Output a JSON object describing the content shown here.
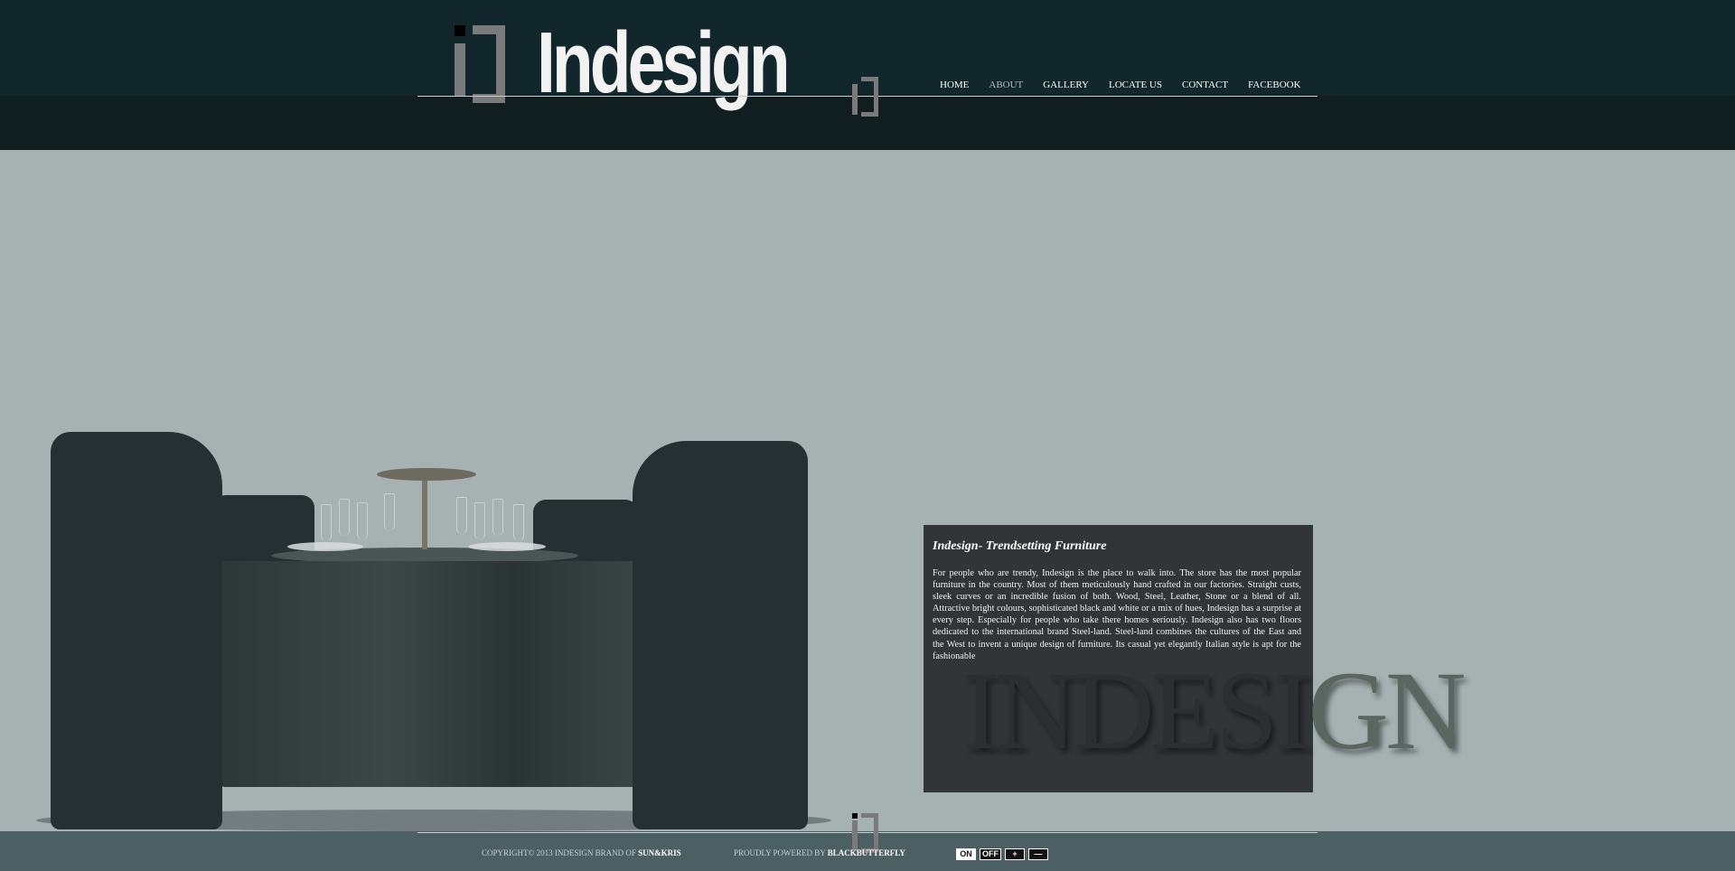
{
  "header": {
    "logo_text": "Indesign",
    "nav": [
      {
        "label": "HOME",
        "active": false
      },
      {
        "label": "ABOUT",
        "active": true
      },
      {
        "label": "GALLERY",
        "active": false
      },
      {
        "label": "LOCATE US",
        "active": false
      },
      {
        "label": "CONTACT",
        "active": false
      },
      {
        "label": "FACEBOOK",
        "active": false
      }
    ]
  },
  "info": {
    "title": "Indesign- Trendsetting Furniture",
    "body": "For people who are trendy, Indesign is the place to walk into. The store has the most popular furniture in the country. Most of them meticulously hand crafted in our factories. Straight custs, sleek curves or an incredible fusion of both. Wood, Steel, Leather, Stone or a blend of all. Attractive bright colours, sophisticated black and white or a mix of hues, Indesign has a surprise at every step. Especially for people who take there homes seriously. Indesign also has two floors dedicated to the international brand Steel-land. Steel-land combines the cultures of the East and the West to invent a unique design of furniture. Its casual yet elegantly Italian style is apt for the fashionable",
    "watermark_inside": "INDESI",
    "watermark_outside": "GN"
  },
  "footer": {
    "copyright_prefix": "COPYRIGHT© 2013 INDESIGN BRAND OF ",
    "copyright_brand": "SUN&KRIS",
    "powered_prefix": "PROUDLY POWERED BY ",
    "powered_brand": "BLACKBUTTERFLY",
    "controls": {
      "on": "ON",
      "off": "OFF",
      "plus": "+",
      "minus": "—"
    }
  },
  "colors": {
    "header_bg": "#11272b",
    "page_bg": "#a6b1b2",
    "info_box_bg": "#323536",
    "footer_bg": "#4c5f63"
  }
}
